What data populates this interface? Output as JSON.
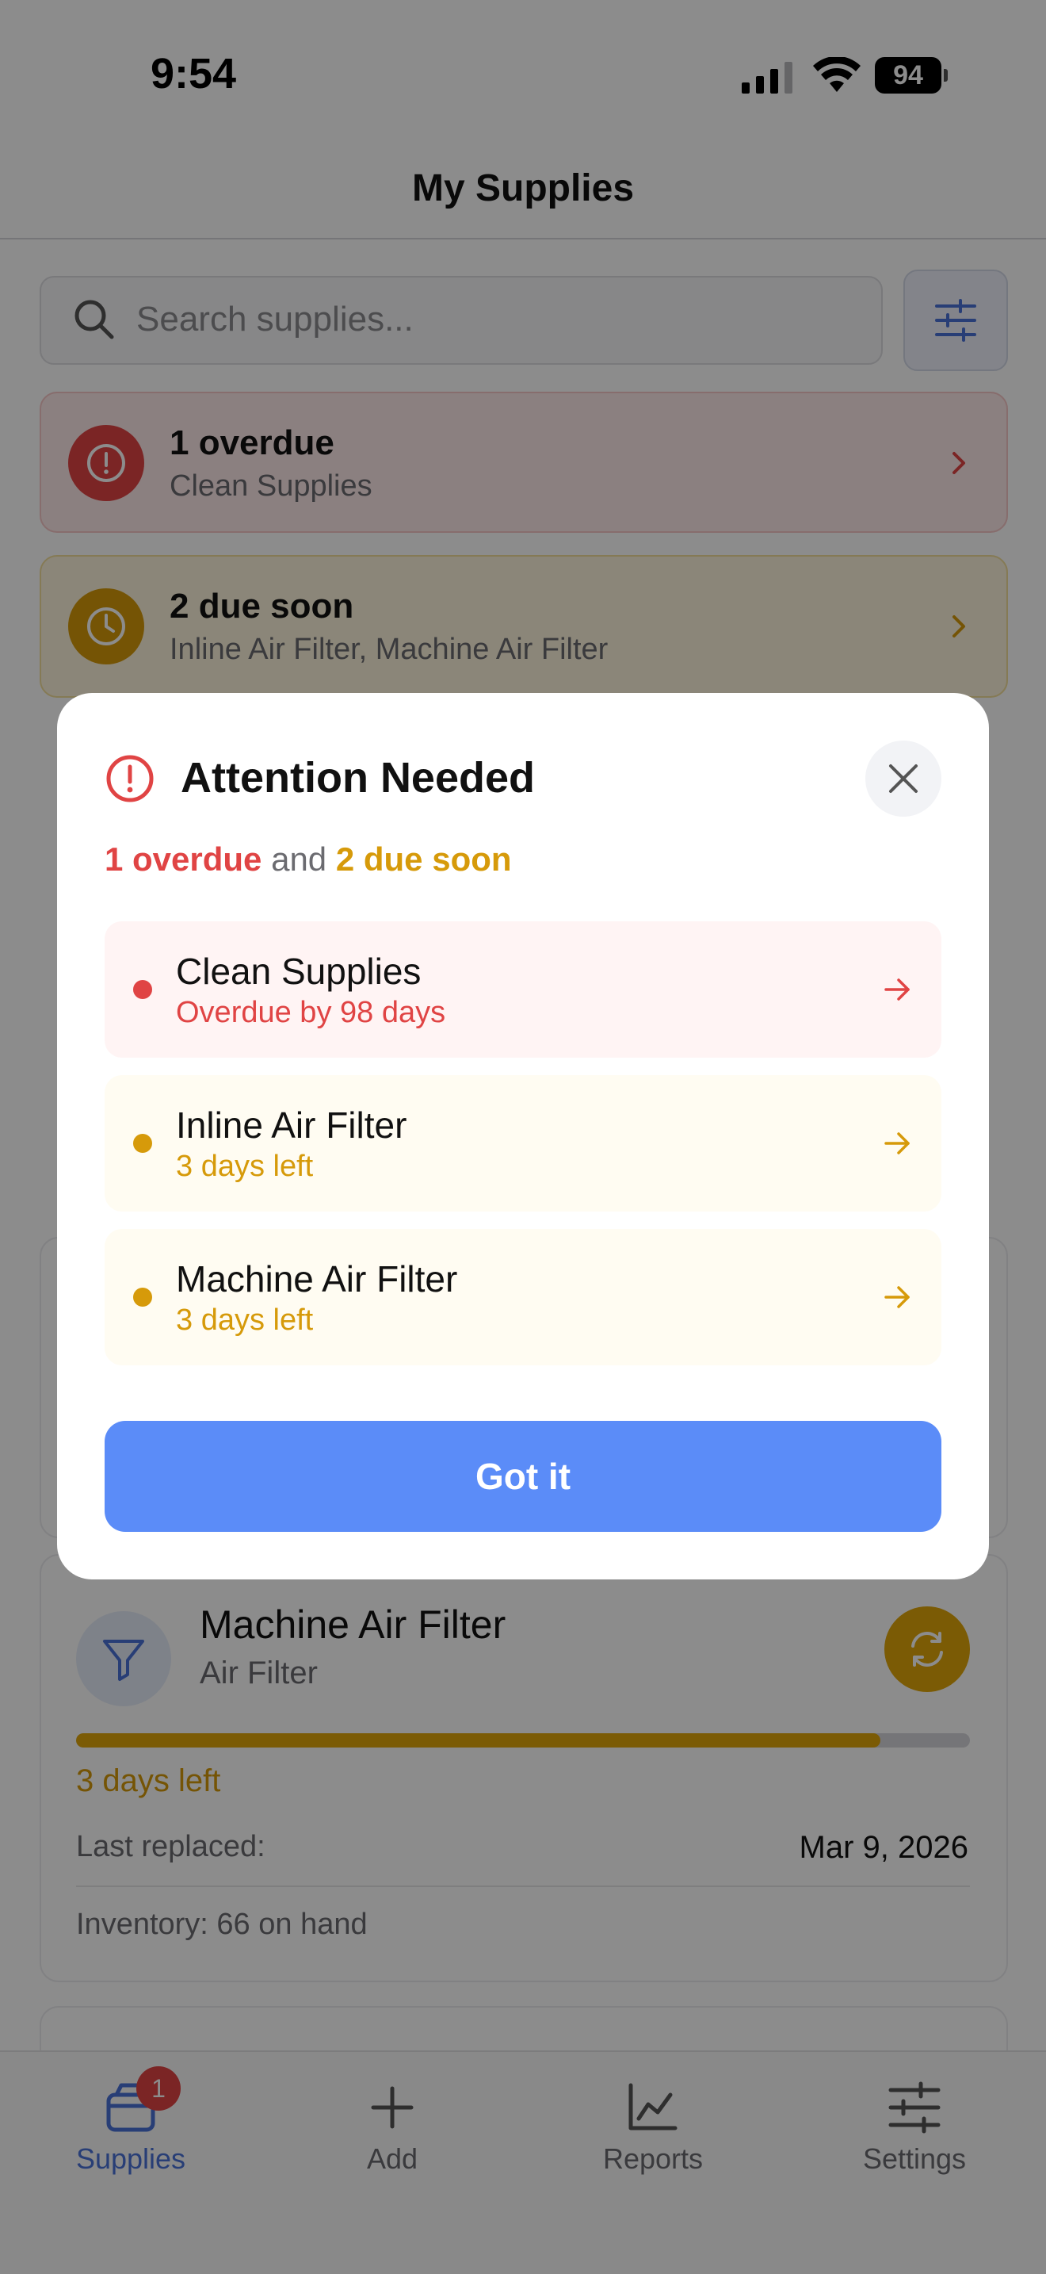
{
  "status_bar": {
    "time": "9:54",
    "battery": "94"
  },
  "nav": {
    "title": "My Supplies"
  },
  "search": {
    "placeholder": "Search supplies..."
  },
  "alerts": {
    "overdue": {
      "title": "1 overdue",
      "subtitle": "Clean Supplies"
    },
    "due_soon": {
      "title": "2 due soon",
      "subtitle": "Inline Air Filter, Machine Air Filter"
    }
  },
  "supply_card": {
    "name": "Machine Air Filter",
    "category": "Air Filter",
    "progress_fraction": 0.9,
    "days_left": "3 days left",
    "last_replaced_label": "Last replaced:",
    "last_replaced_value": "Mar 9, 2026",
    "inventory": "Inventory: 66 on hand"
  },
  "tabs": [
    {
      "label": "Supplies",
      "icon": "box-icon",
      "active": true,
      "badge": "1"
    },
    {
      "label": "Add",
      "icon": "plus-icon",
      "active": false
    },
    {
      "label": "Reports",
      "icon": "chart-icon",
      "active": false
    },
    {
      "label": "Settings",
      "icon": "sliders-icon",
      "active": false
    }
  ],
  "modal": {
    "title": "Attention Needed",
    "summary_overdue": "1 overdue",
    "summary_and": "and",
    "summary_soon": "2 due soon",
    "items": [
      {
        "title": "Clean Supplies",
        "subtitle": "Overdue by 98 days",
        "status": "overdue"
      },
      {
        "title": "Inline Air Filter",
        "subtitle": "3 days left",
        "status": "soon"
      },
      {
        "title": "Machine Air Filter",
        "subtitle": "3 days left",
        "status": "soon"
      }
    ],
    "button": "Got it"
  },
  "colors": {
    "accent": "#5b8cf8",
    "overdue": "#e04444",
    "soon": "#d69a0a"
  }
}
